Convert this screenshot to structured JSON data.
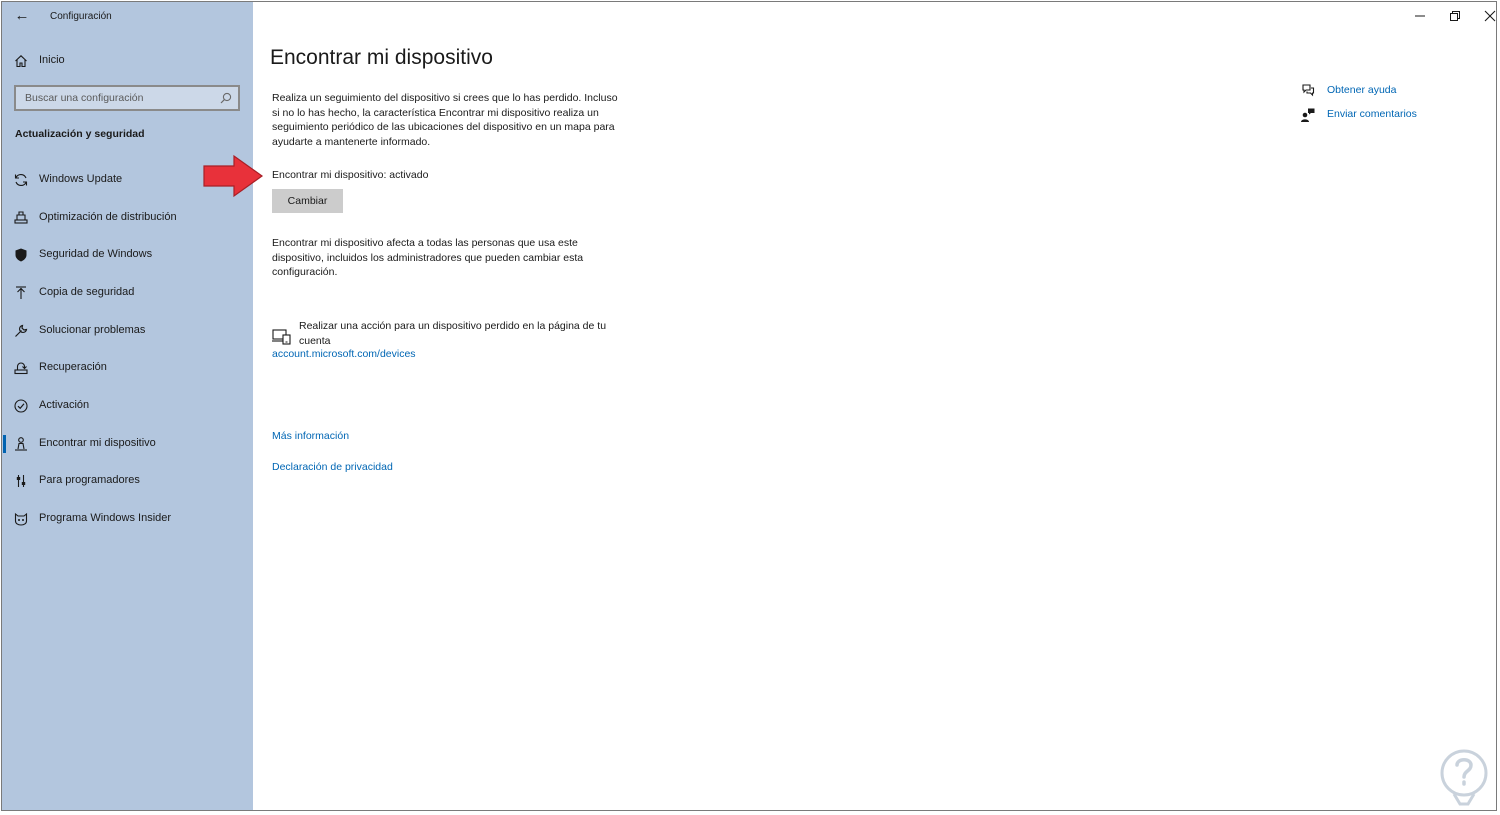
{
  "window": {
    "title": "Configuración"
  },
  "sidebar": {
    "home_label": "Inicio",
    "search_placeholder": "Buscar una configuración",
    "section_title": "Actualización y seguridad",
    "items": [
      {
        "label": "Windows Update",
        "icon": "refresh-icon"
      },
      {
        "label": "Optimización de distribución",
        "icon": "delivery-optimization-icon"
      },
      {
        "label": "Seguridad de Windows",
        "icon": "shield-icon"
      },
      {
        "label": "Copia de seguridad",
        "icon": "backup-arrow-icon"
      },
      {
        "label": "Solucionar problemas",
        "icon": "wrench-icon"
      },
      {
        "label": "Recuperación",
        "icon": "recovery-icon"
      },
      {
        "label": "Activación",
        "icon": "checkmark-circle-icon"
      },
      {
        "label": "Encontrar mi dispositivo",
        "icon": "person-locate-icon",
        "active": true
      },
      {
        "label": "Para programadores",
        "icon": "developer-sliders-icon"
      },
      {
        "label": "Programa Windows Insider",
        "icon": "insider-cat-icon"
      }
    ]
  },
  "main": {
    "title": "Encontrar mi dispositivo",
    "description": "Realiza un seguimiento del dispositivo si crees que lo has perdido. Incluso si no lo has hecho, la característica Encontrar mi dispositivo realiza un seguimiento periódico de las ubicaciones del dispositivo en un mapa para ayudarte a mantenerte informado.",
    "status": "Encontrar mi dispositivo: activado",
    "change_button": "Cambiar",
    "note": "Encontrar mi dispositivo afecta a todas las personas que usa este dispositivo, incluidos los administradores que pueden cambiar esta configuración.",
    "action_text": "Realizar una acción para un dispositivo perdido en la página de tu cuenta",
    "account_link": "account.microsoft.com/devices",
    "more_info_link": "Más información",
    "privacy_link": "Declaración de privacidad"
  },
  "help": {
    "get_help": "Obtener ayuda",
    "feedback": "Enviar comentarios"
  },
  "colors": {
    "sidebar_bg": "#b3c6de",
    "link": "#0066b4",
    "accent_indicator": "#0063b1",
    "annotation_arrow": "#e8313a"
  }
}
